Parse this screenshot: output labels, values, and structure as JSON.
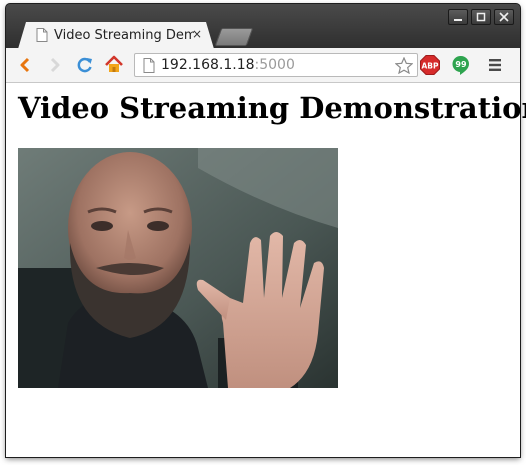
{
  "tab": {
    "title": "Video Streaming Dem",
    "close": "×"
  },
  "toolbar": {
    "url_host": "192.168.1.18",
    "url_port": ":5000",
    "extensions": {
      "abp_label": "ABP",
      "hangouts_label": "99"
    }
  },
  "page": {
    "heading": "Video Streaming Demonstration"
  },
  "video": {
    "description_icon": "video-stream-frame"
  }
}
